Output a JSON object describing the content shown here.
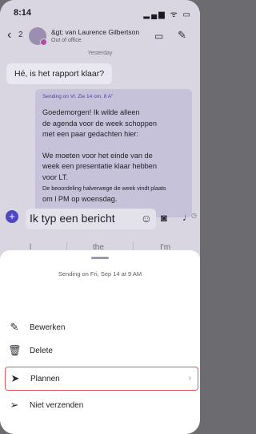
{
  "status_bar": {
    "time": "8:14",
    "icons": "▂▄▆ ᯤ ▭"
  },
  "header": {
    "back_glyph": "‹",
    "badge": "2",
    "name": "&gt; van Laurence Gilbertson",
    "status": "Out of office",
    "video_glyph": "▭",
    "edit_glyph": "✎"
  },
  "chat": {
    "day_label": "Yesterday",
    "message1": "Hé, is het rapport klaar?",
    "scheduled": {
      "sending_label": "Sending on Vr. Zie 14 om. 8 A\"",
      "lines": [
        "Goedemorgen! Ik wilde alleen",
        "de agenda voor de week schoppen",
        "met een paar gedachten hier:",
        "We moeten voor het einde van de",
        "week een presentatie klaar hebben",
        "voor LT.",
        "De beoordeling halverwege de week vindt plaats",
        "om l PM op woensdag."
      ]
    }
  },
  "compose": {
    "plus": "+",
    "placeholder": "Ik typ een bericht",
    "emoji": "☺",
    "camera": "◙",
    "mic": "♩"
  },
  "suggestions": [
    "l",
    "the",
    "I'm"
  ],
  "sheet": {
    "title": "Sending on Fri, Sep 14 at 9 AM",
    "items": [
      {
        "label": "Bewerken",
        "icon": "✎",
        "icon_name": "pencil-icon"
      },
      {
        "label": "Delete",
        "icon": "🗑",
        "icon_name": "trash-icon"
      },
      {
        "label": "Plannen",
        "icon": "➤",
        "icon_name": "send-clock-icon",
        "selected": true
      },
      {
        "label": "Niet verzenden",
        "icon": "➢",
        "icon_name": "send-icon"
      }
    ],
    "chevron": "›"
  },
  "colors": {
    "accent": "#4d47c6",
    "highlight_border": "#e0555d",
    "scheduled_bubble": "#c6c2da"
  }
}
